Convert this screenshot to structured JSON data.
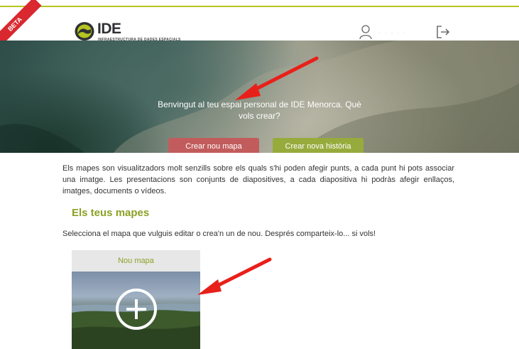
{
  "header": {
    "beta_label": "BETA",
    "logo_title": "IDE menorca",
    "logo_subtitle": "INFRAESTRUCTURA DE DADES ESPACIALS",
    "user_name": "· · · · ·"
  },
  "hero": {
    "welcome_text": "Benvingut al teu espai personal de IDE Menorca. Què vols crear?",
    "create_map_button": "Crear nou mapa",
    "create_story_button": "Crear nova història"
  },
  "intro": {
    "text": "Els mapes son visualitzadors molt senzills sobre els quals s'hi poden afegir punts, a cada punt hi pots associar una imatge. Les presentacions son conjunts de diapositives, a cada diapositiva hi podràs afegir enllaços, imatges, documents o vídeos."
  },
  "maps_section": {
    "title": "Els teus mapes",
    "subtitle": "Selecciona el mapa que vulguis editar o crea'n un de nou. Després comparteix-lo... si vols!"
  },
  "new_map_card": {
    "label": "Nou mapa"
  },
  "colors": {
    "accent_green": "#8ba125",
    "button_red": "#c25c5c",
    "button_green": "#97ab3d",
    "beta_red": "#d9282f",
    "annotation_arrow": "#e8201a"
  }
}
